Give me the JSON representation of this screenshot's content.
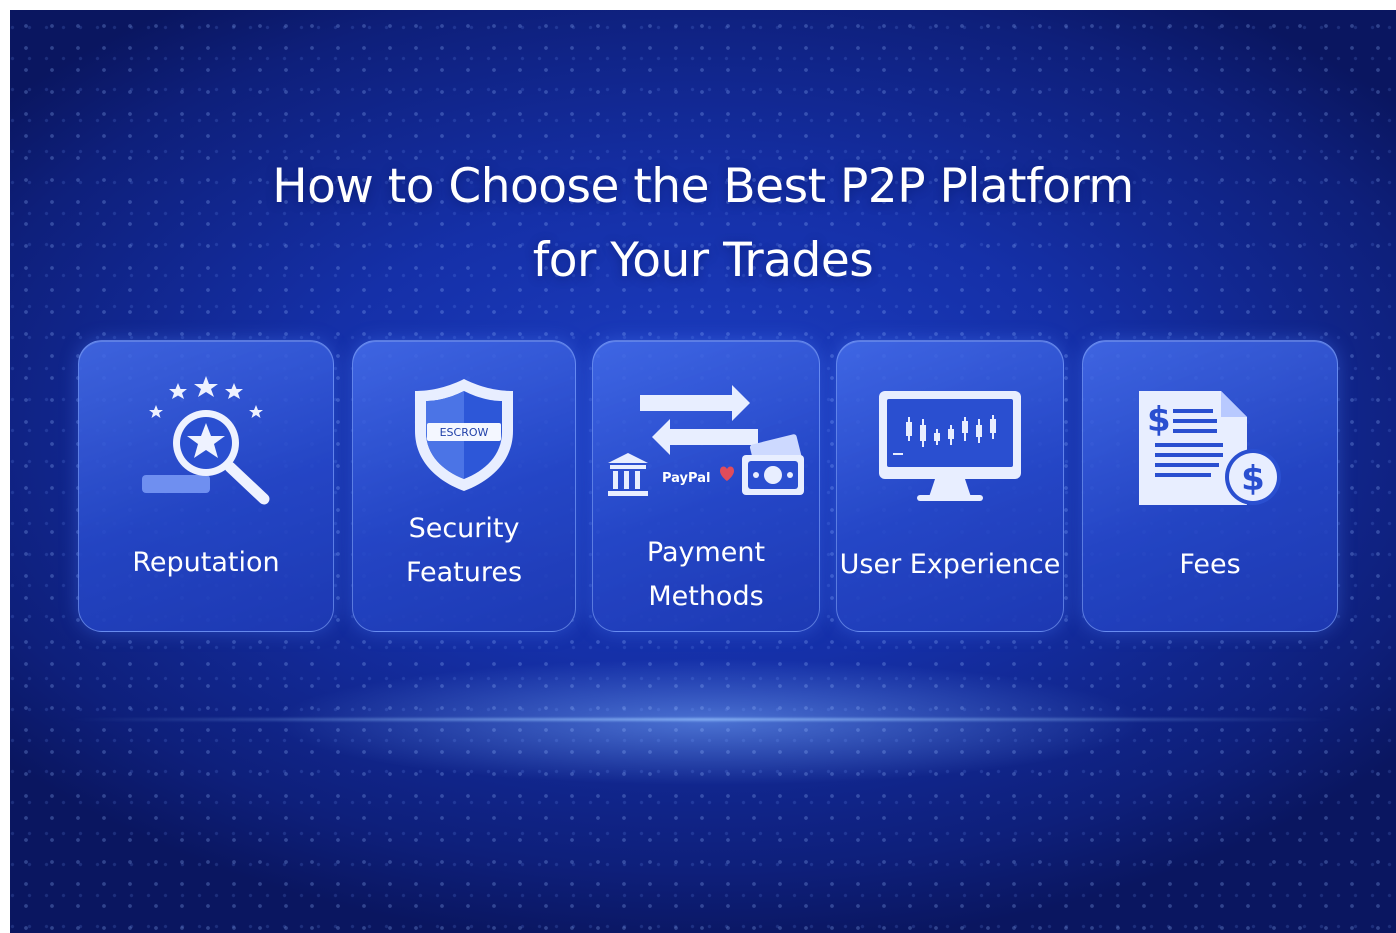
{
  "title": {
    "line1": "How to Choose the Best P2P Platform",
    "line2": "for Your Trades"
  },
  "cards": [
    {
      "label": "Reputation",
      "icon": "star-magnifier-icon"
    },
    {
      "label": "Security\nFeatures",
      "icon": "shield-icon",
      "badge": "ESCROW"
    },
    {
      "label": "Payment\nMethods",
      "icon": "payment-exchange-icon",
      "brand": "PayPal"
    },
    {
      "label": "User Experience",
      "icon": "monitor-chart-icon"
    },
    {
      "label": "Fees",
      "icon": "invoice-dollar-icon"
    }
  ],
  "colors": {
    "background": "#1530a8",
    "card": "#2a4fd0",
    "icon": "#e8eeff",
    "text": "#ffffff"
  }
}
